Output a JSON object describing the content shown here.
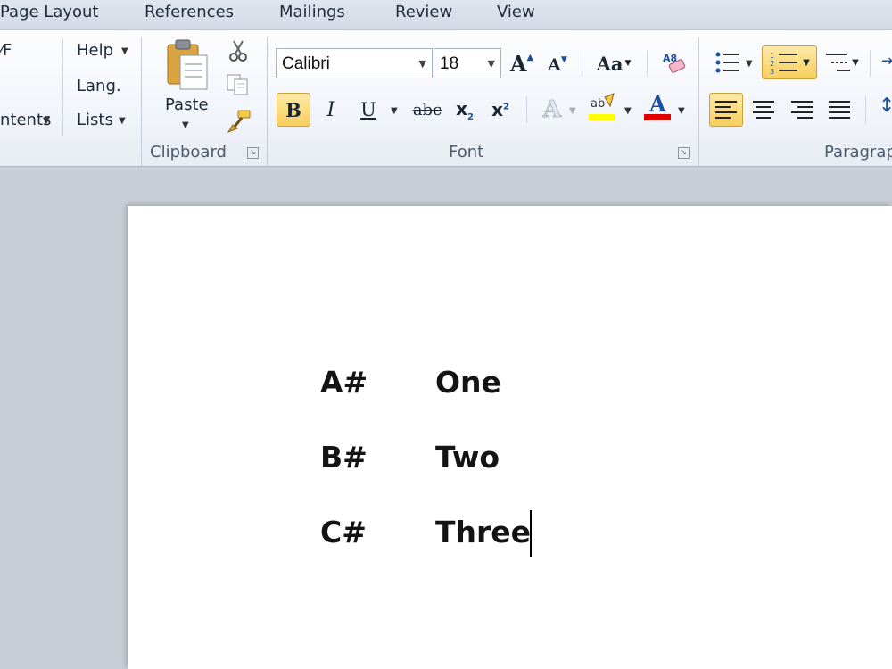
{
  "tabs": [
    "Page Layout",
    "References",
    "Mailings",
    "Review",
    "View"
  ],
  "left_group": {
    "items": [
      "⁄F",
      "ntents"
    ]
  },
  "tools_group": {
    "help": "Help",
    "lang": "Lang.",
    "lists": "Lists"
  },
  "clipboard": {
    "paste_label": "Paste",
    "group_label": "Clipboard"
  },
  "font": {
    "font_name": "Calibri",
    "font_size": "18",
    "group_label": "Font",
    "change_case_label": "Aa"
  },
  "paragraph": {
    "group_label": "Paragrap"
  },
  "document": {
    "rows": [
      {
        "col1": "A#",
        "col2": "One"
      },
      {
        "col1": "B#",
        "col2": "Two"
      },
      {
        "col1": "C#",
        "col2": "Three"
      }
    ]
  },
  "colors": {
    "highlight": "#ffff00",
    "font_color": "#e00000",
    "active_button": "#f8cf5d"
  }
}
